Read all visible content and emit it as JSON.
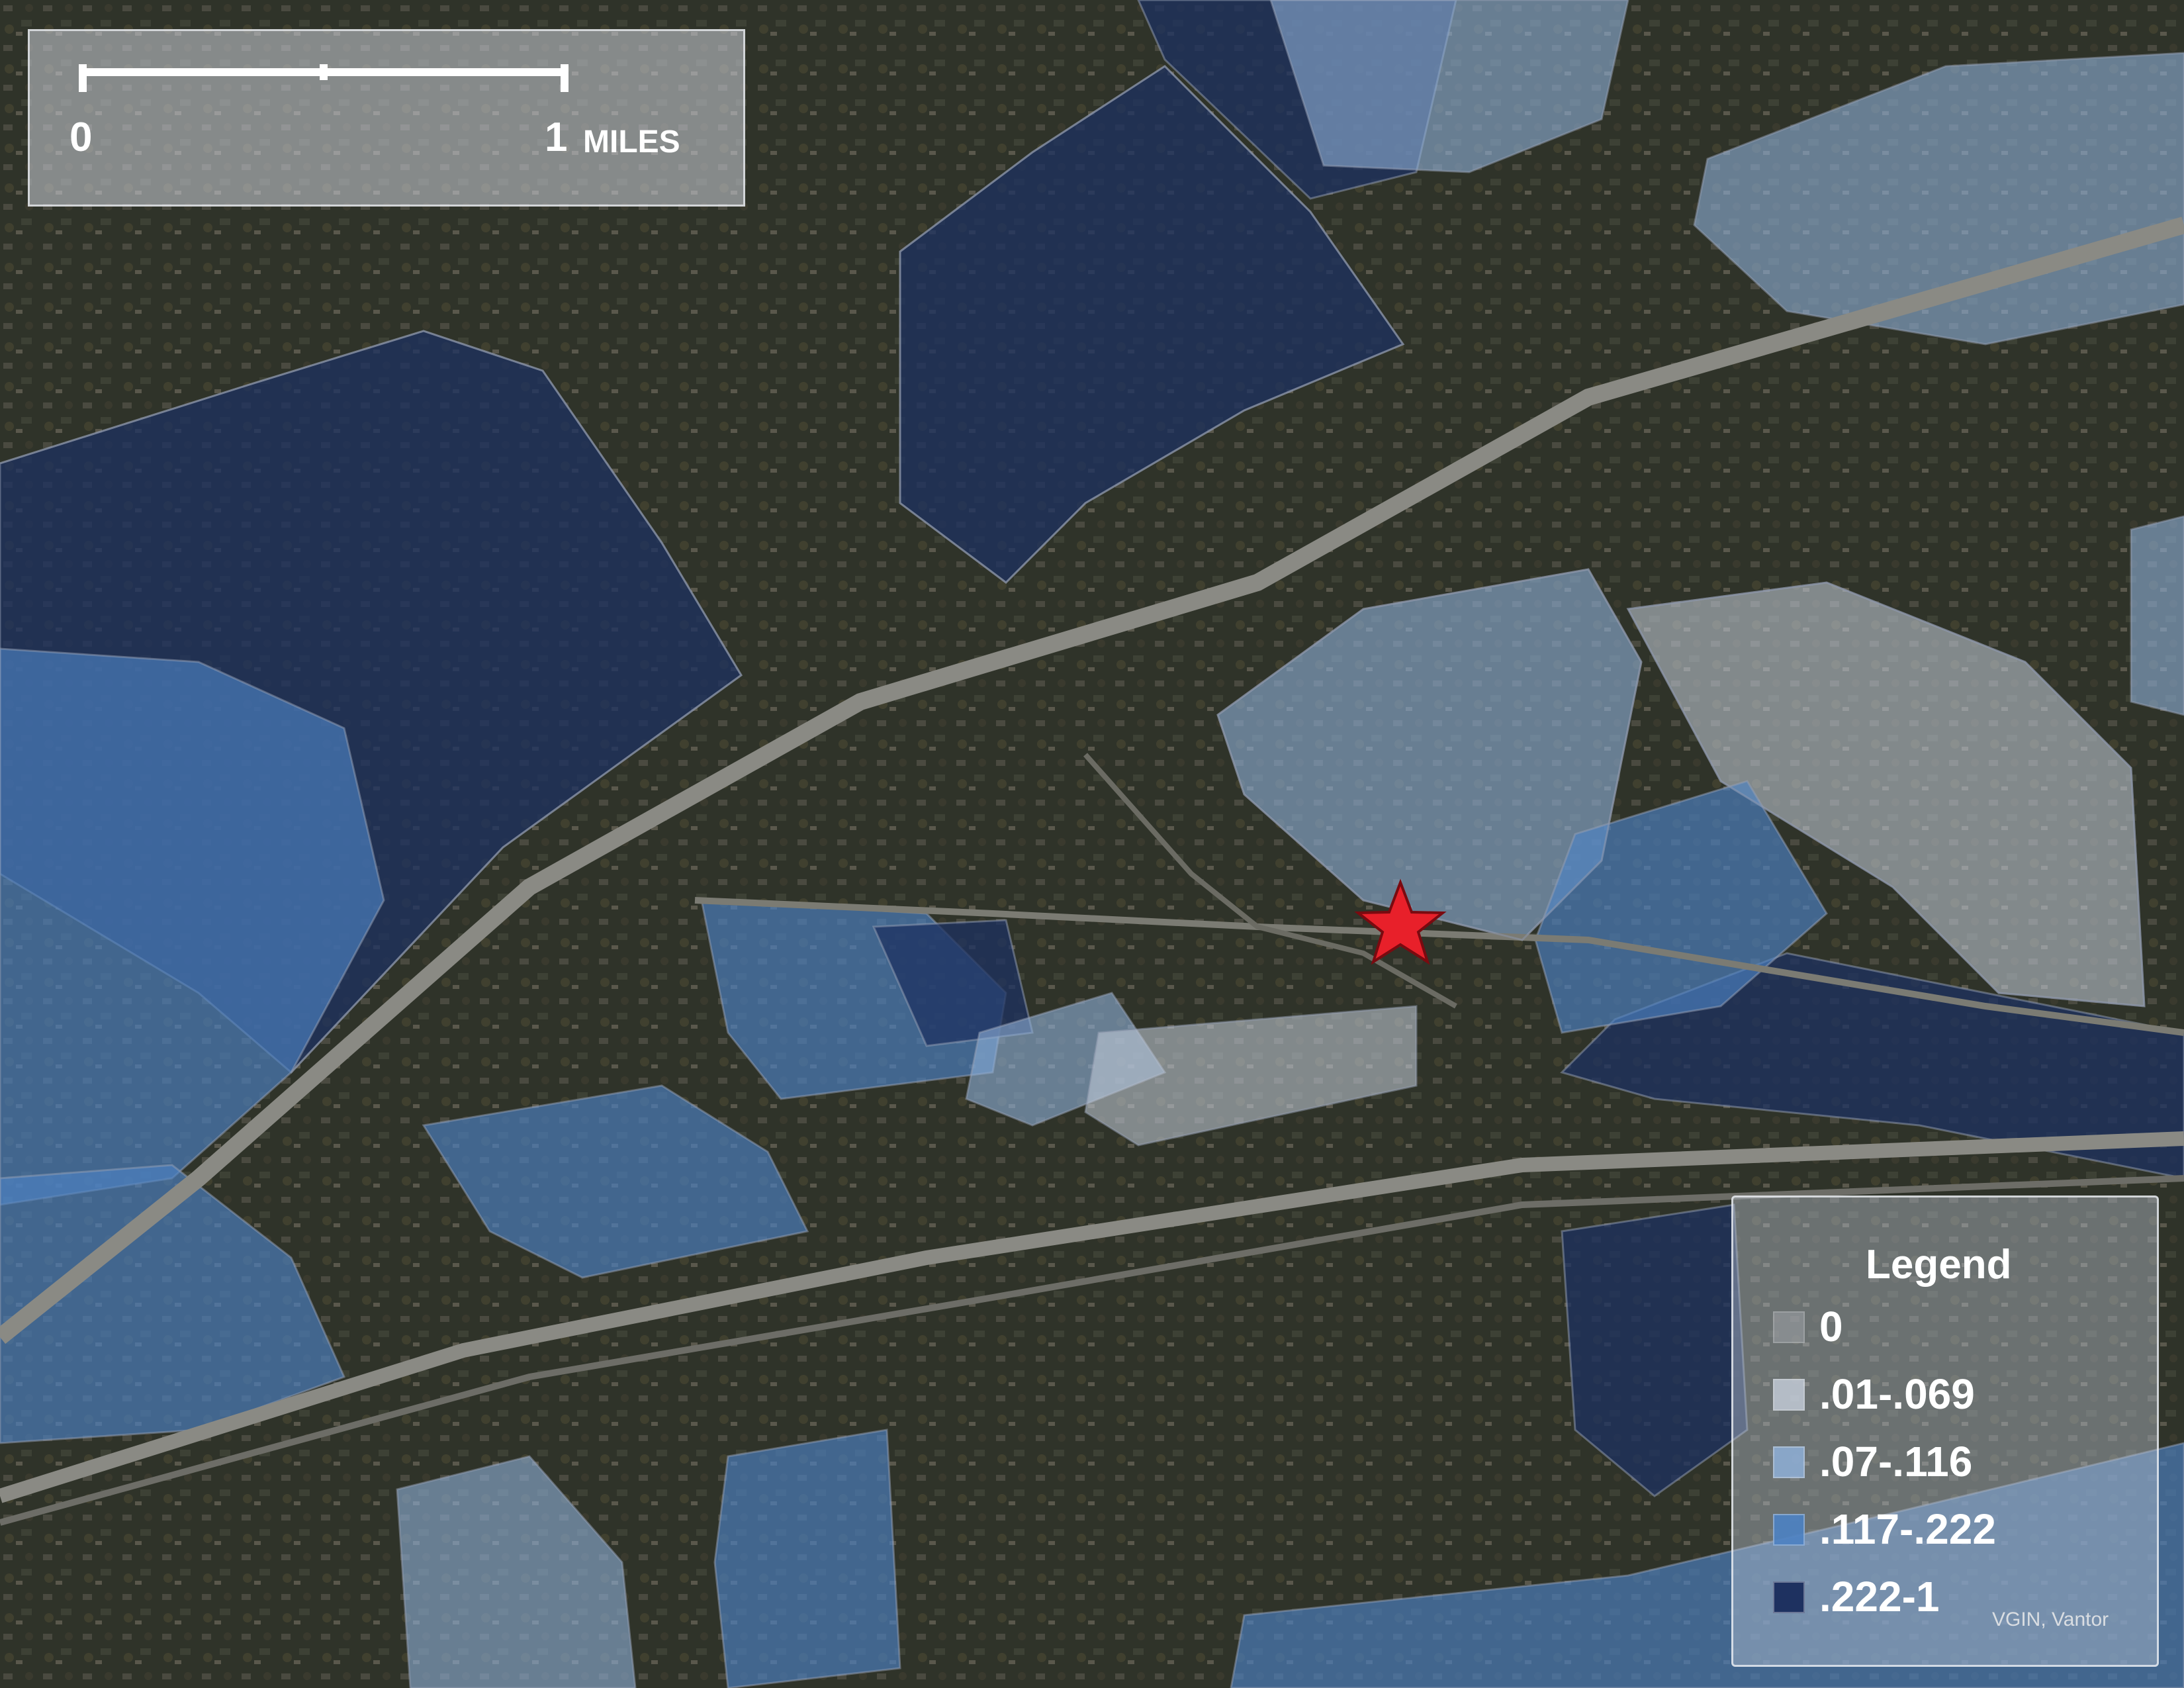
{
  "scale_bar": {
    "label_start": "0",
    "label_end": "1",
    "unit": "MILES"
  },
  "legend": {
    "title": "Legend",
    "items": [
      {
        "label": "0",
        "color": "#9b9ea3",
        "opacity": 0.35
      },
      {
        "label": ".01-.069",
        "color": "#c7cfdc",
        "opacity": 0.55
      },
      {
        "label": ".07-.116",
        "color": "#8fb0d8",
        "opacity": 0.6
      },
      {
        "label": ".117-.222",
        "color": "#4d82c4",
        "opacity": 0.65
      },
      {
        "label": ".222-1",
        "color": "#1e3160",
        "opacity": 0.75
      }
    ]
  },
  "marker": {
    "icon": "red-star-icon",
    "color": "#e8202a"
  },
  "credit": "VGIN, Vantor",
  "colors": {
    "imagery_base": "#2c3027",
    "road": "#8a8a84"
  }
}
